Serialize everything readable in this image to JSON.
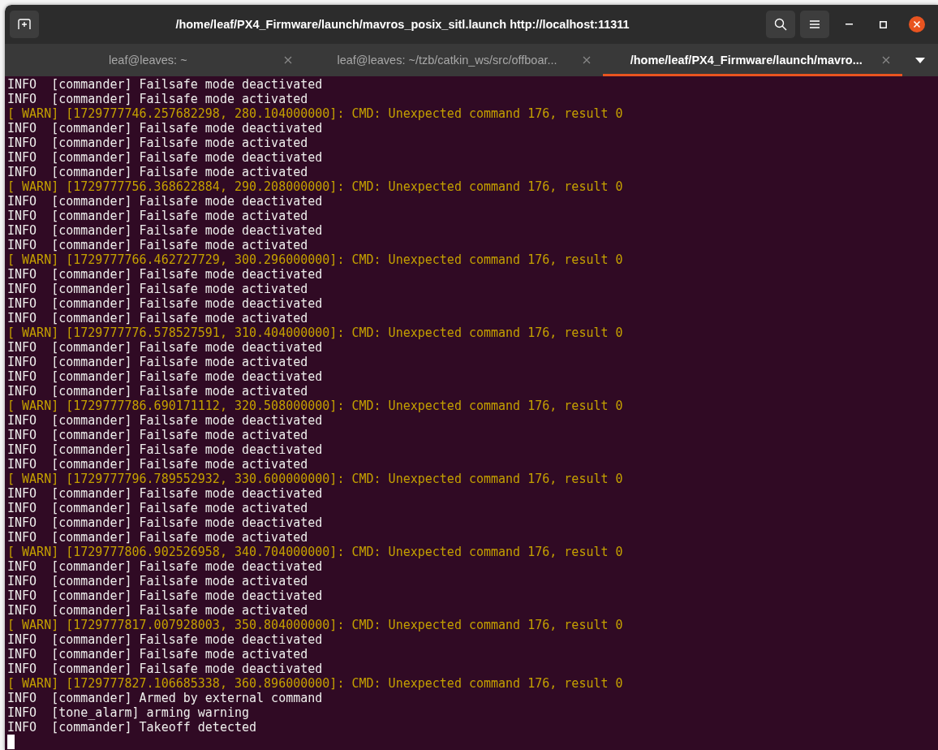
{
  "window": {
    "title": "/home/leaf/PX4_Firmware/launch/mavros_posix_sitl.launch http://localhost:11311"
  },
  "tabs": [
    {
      "label": "leaf@leaves: ~",
      "selected": false
    },
    {
      "label": "leaf@leaves: ~/tzb/catkin_ws/src/offboar...",
      "selected": false
    },
    {
      "label": "/home/leaf/PX4_Firmware/launch/mavro...",
      "selected": true
    }
  ],
  "terminal": {
    "lines": [
      {
        "kind": "info",
        "text": "INFO  [commander] Failsafe mode deactivated"
      },
      {
        "kind": "info",
        "text": "INFO  [commander] Failsafe mode activated"
      },
      {
        "kind": "warn",
        "text": "[ WARN] [1729777746.257682298, 280.104000000]: CMD: Unexpected command 176, result 0"
      },
      {
        "kind": "info",
        "text": "INFO  [commander] Failsafe mode deactivated"
      },
      {
        "kind": "info",
        "text": "INFO  [commander] Failsafe mode activated"
      },
      {
        "kind": "info",
        "text": "INFO  [commander] Failsafe mode deactivated"
      },
      {
        "kind": "info",
        "text": "INFO  [commander] Failsafe mode activated"
      },
      {
        "kind": "warn",
        "text": "[ WARN] [1729777756.368622884, 290.208000000]: CMD: Unexpected command 176, result 0"
      },
      {
        "kind": "info",
        "text": "INFO  [commander] Failsafe mode deactivated"
      },
      {
        "kind": "info",
        "text": "INFO  [commander] Failsafe mode activated"
      },
      {
        "kind": "info",
        "text": "INFO  [commander] Failsafe mode deactivated"
      },
      {
        "kind": "info",
        "text": "INFO  [commander] Failsafe mode activated"
      },
      {
        "kind": "warn",
        "text": "[ WARN] [1729777766.462727729, 300.296000000]: CMD: Unexpected command 176, result 0"
      },
      {
        "kind": "info",
        "text": "INFO  [commander] Failsafe mode deactivated"
      },
      {
        "kind": "info",
        "text": "INFO  [commander] Failsafe mode activated"
      },
      {
        "kind": "info",
        "text": "INFO  [commander] Failsafe mode deactivated"
      },
      {
        "kind": "info",
        "text": "INFO  [commander] Failsafe mode activated"
      },
      {
        "kind": "warn",
        "text": "[ WARN] [1729777776.578527591, 310.404000000]: CMD: Unexpected command 176, result 0"
      },
      {
        "kind": "info",
        "text": "INFO  [commander] Failsafe mode deactivated"
      },
      {
        "kind": "info",
        "text": "INFO  [commander] Failsafe mode activated"
      },
      {
        "kind": "info",
        "text": "INFO  [commander] Failsafe mode deactivated"
      },
      {
        "kind": "info",
        "text": "INFO  [commander] Failsafe mode activated"
      },
      {
        "kind": "warn",
        "text": "[ WARN] [1729777786.690171112, 320.508000000]: CMD: Unexpected command 176, result 0"
      },
      {
        "kind": "info",
        "text": "INFO  [commander] Failsafe mode deactivated"
      },
      {
        "kind": "info",
        "text": "INFO  [commander] Failsafe mode activated"
      },
      {
        "kind": "info",
        "text": "INFO  [commander] Failsafe mode deactivated"
      },
      {
        "kind": "info",
        "text": "INFO  [commander] Failsafe mode activated"
      },
      {
        "kind": "warn",
        "text": "[ WARN] [1729777796.789552932, 330.600000000]: CMD: Unexpected command 176, result 0"
      },
      {
        "kind": "info",
        "text": "INFO  [commander] Failsafe mode deactivated"
      },
      {
        "kind": "info",
        "text": "INFO  [commander] Failsafe mode activated"
      },
      {
        "kind": "info",
        "text": "INFO  [commander] Failsafe mode deactivated"
      },
      {
        "kind": "info",
        "text": "INFO  [commander] Failsafe mode activated"
      },
      {
        "kind": "warn",
        "text": "[ WARN] [1729777806.902526958, 340.704000000]: CMD: Unexpected command 176, result 0"
      },
      {
        "kind": "info",
        "text": "INFO  [commander] Failsafe mode deactivated"
      },
      {
        "kind": "info",
        "text": "INFO  [commander] Failsafe mode activated"
      },
      {
        "kind": "info",
        "text": "INFO  [commander] Failsafe mode deactivated"
      },
      {
        "kind": "info",
        "text": "INFO  [commander] Failsafe mode activated"
      },
      {
        "kind": "warn",
        "text": "[ WARN] [1729777817.007928003, 350.804000000]: CMD: Unexpected command 176, result 0"
      },
      {
        "kind": "info",
        "text": "INFO  [commander] Failsafe mode deactivated"
      },
      {
        "kind": "info",
        "text": "INFO  [commander] Failsafe mode activated"
      },
      {
        "kind": "info",
        "text": "INFO  [commander] Failsafe mode deactivated"
      },
      {
        "kind": "warn",
        "text": "[ WARN] [1729777827.106685338, 360.896000000]: CMD: Unexpected command 176, result 0"
      },
      {
        "kind": "info",
        "text": "INFO  [commander] Armed by external command"
      },
      {
        "kind": "info",
        "text": "INFO  [tone_alarm] arming warning"
      },
      {
        "kind": "info",
        "text": "INFO  [commander] Takeoff detected"
      }
    ]
  }
}
